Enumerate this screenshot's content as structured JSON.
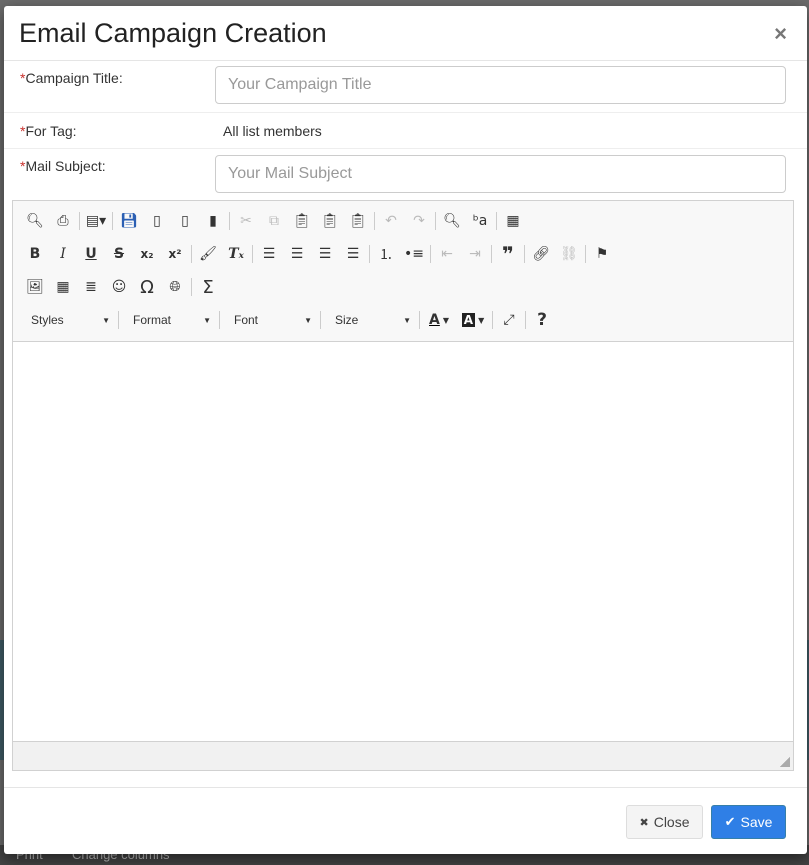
{
  "modal": {
    "title": "Email Campaign Creation",
    "close_glyph": "×"
  },
  "form": {
    "required_mark": "*",
    "campaign_title": {
      "label": "Campaign Title:",
      "placeholder": "Your Campaign Title",
      "value": ""
    },
    "for_tag": {
      "label": "For Tag:",
      "value": "All list members"
    },
    "mail_subject": {
      "label": "Mail Subject:",
      "placeholder": "Your Mail Subject",
      "value": ""
    }
  },
  "editor": {
    "toolbar_row1": [
      {
        "icon": "preview-icon",
        "glyph": "🔍︎"
      },
      {
        "icon": "print-icon",
        "glyph": "⎙"
      },
      {
        "icon": "templates-icon",
        "glyph": "▤▾"
      },
      {
        "icon": "save-icon",
        "glyph": "💾︎"
      },
      {
        "icon": "new-page-icon",
        "glyph": "▯"
      },
      {
        "icon": "blank-page-icon",
        "glyph": "▯"
      },
      {
        "icon": "export-pdf-icon",
        "glyph": "▮"
      },
      {
        "icon": "cut-icon",
        "glyph": "✂"
      },
      {
        "icon": "copy-icon",
        "glyph": "⧉"
      },
      {
        "icon": "paste-icon",
        "glyph": "📋︎"
      },
      {
        "icon": "paste-text-icon",
        "glyph": "📋︎"
      },
      {
        "icon": "paste-word-icon",
        "glyph": "📋︎"
      },
      {
        "icon": "undo-icon",
        "glyph": "↶"
      },
      {
        "icon": "redo-icon",
        "glyph": "↷"
      },
      {
        "icon": "find-icon",
        "glyph": "🔍︎"
      },
      {
        "icon": "replace-icon",
        "glyph": "ᵇa"
      },
      {
        "icon": "select-all-icon",
        "glyph": "▦"
      }
    ],
    "toolbar_row2": [
      {
        "icon": "bold-icon",
        "glyph": "B"
      },
      {
        "icon": "italic-icon",
        "glyph": "I"
      },
      {
        "icon": "underline-icon",
        "glyph": "U"
      },
      {
        "icon": "strikethrough-icon",
        "glyph": "S"
      },
      {
        "icon": "subscript-icon",
        "glyph": "x₂"
      },
      {
        "icon": "superscript-icon",
        "glyph": "x²"
      },
      {
        "icon": "format-painter-icon",
        "glyph": "🖌︎"
      },
      {
        "icon": "remove-format-icon",
        "glyph": "Tₓ"
      },
      {
        "icon": "align-left-icon",
        "glyph": "☰"
      },
      {
        "icon": "align-center-icon",
        "glyph": "☰"
      },
      {
        "icon": "align-right-icon",
        "glyph": "☰"
      },
      {
        "icon": "align-justify-icon",
        "glyph": "☰"
      },
      {
        "icon": "numbered-list-icon",
        "glyph": "⒈"
      },
      {
        "icon": "bulleted-list-icon",
        "glyph": "•≡"
      },
      {
        "icon": "outdent-icon",
        "glyph": "⇤"
      },
      {
        "icon": "indent-icon",
        "glyph": "⇥"
      },
      {
        "icon": "blockquote-icon",
        "glyph": "❞"
      },
      {
        "icon": "link-icon",
        "glyph": "🔗︎"
      },
      {
        "icon": "unlink-icon",
        "glyph": "⛓"
      },
      {
        "icon": "anchor-flag-icon",
        "glyph": "⚑"
      }
    ],
    "toolbar_row3": [
      {
        "icon": "image-icon",
        "glyph": "🖼︎"
      },
      {
        "icon": "table-icon",
        "glyph": "▦"
      },
      {
        "icon": "horizontal-line-icon",
        "glyph": "≣"
      },
      {
        "icon": "smiley-icon",
        "glyph": "☺"
      },
      {
        "icon": "special-char-icon",
        "glyph": "Ω"
      },
      {
        "icon": "iframe-globe-icon",
        "glyph": "🌐︎"
      },
      {
        "icon": "math-sigma-icon",
        "glyph": "Σ"
      }
    ],
    "combos": {
      "styles": "Styles",
      "format": "Format",
      "font": "Font",
      "size": "Size"
    },
    "row4_icons": [
      {
        "icon": "text-color-icon",
        "glyph": "A"
      },
      {
        "icon": "bg-color-icon",
        "glyph": "A"
      },
      {
        "icon": "maximize-icon",
        "glyph": "⤢"
      },
      {
        "icon": "help-icon",
        "glyph": "?"
      }
    ]
  },
  "footer": {
    "close_label": "Close",
    "close_glyph": "✖",
    "save_label": "Save",
    "save_glyph": "✔"
  },
  "background": {
    "bottom_left_text": "Print",
    "bottom_mid_text": "Change columns"
  },
  "colors": {
    "required": "#c9302c",
    "save_button": "#2f7fe6"
  }
}
